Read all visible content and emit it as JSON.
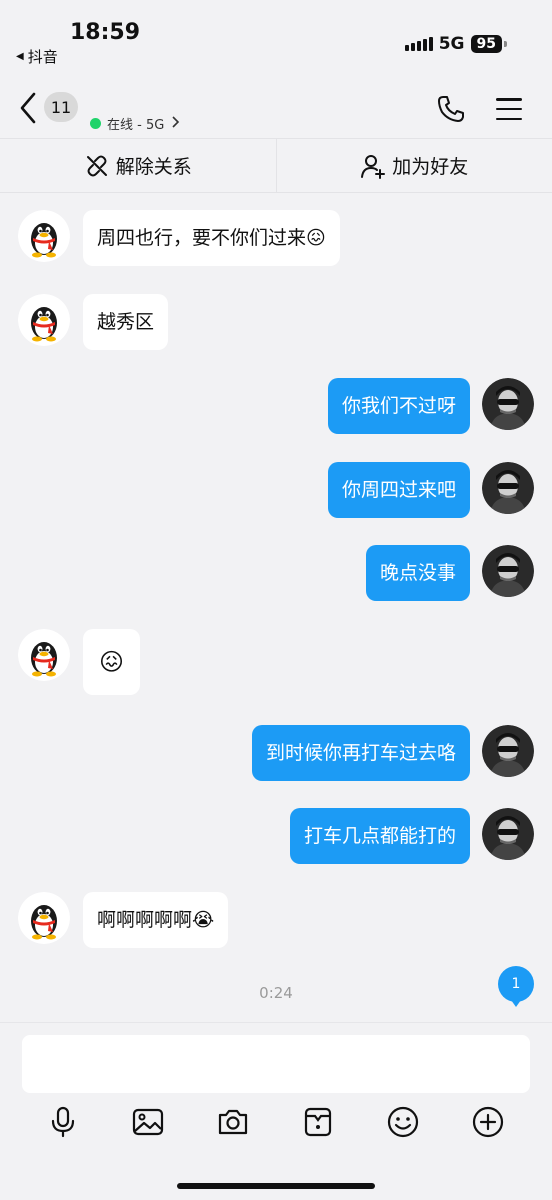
{
  "status_bar": {
    "time": "18:59",
    "back_app": "抖音",
    "network": "5G",
    "battery": "95"
  },
  "header": {
    "unread_count": "11",
    "status": "在线 - 5G",
    "status_color": "#1fd36a"
  },
  "actions": {
    "unlink": "解除关系",
    "add_friend": "加为好友"
  },
  "messages": [
    {
      "side": "left",
      "text": "周四也行，要不你们过来😖"
    },
    {
      "side": "left",
      "text": "越秀区"
    },
    {
      "side": "right",
      "text": "你我们不过呀"
    },
    {
      "side": "right",
      "text": "你周四过来吧"
    },
    {
      "side": "right",
      "text": "晚点没事"
    },
    {
      "side": "left",
      "text": "😖"
    },
    {
      "side": "right",
      "text": "到时候你再打车过去咯"
    },
    {
      "side": "right",
      "text": "打车几点都能打的"
    },
    {
      "side": "left",
      "text": "啊啊啊啊啊😭"
    }
  ],
  "timestamp": "0:24",
  "unread_badge": "1",
  "composer": {
    "placeholder": "",
    "value": ""
  },
  "toolbar": [
    "microphone-icon",
    "image-icon",
    "camera-icon",
    "sticker-icon",
    "emoji-icon",
    "plus-icon"
  ],
  "colors": {
    "outgoing_bubble": "#1c9bf5",
    "incoming_bubble": "#ffffff",
    "background": "#f2f2f4"
  }
}
